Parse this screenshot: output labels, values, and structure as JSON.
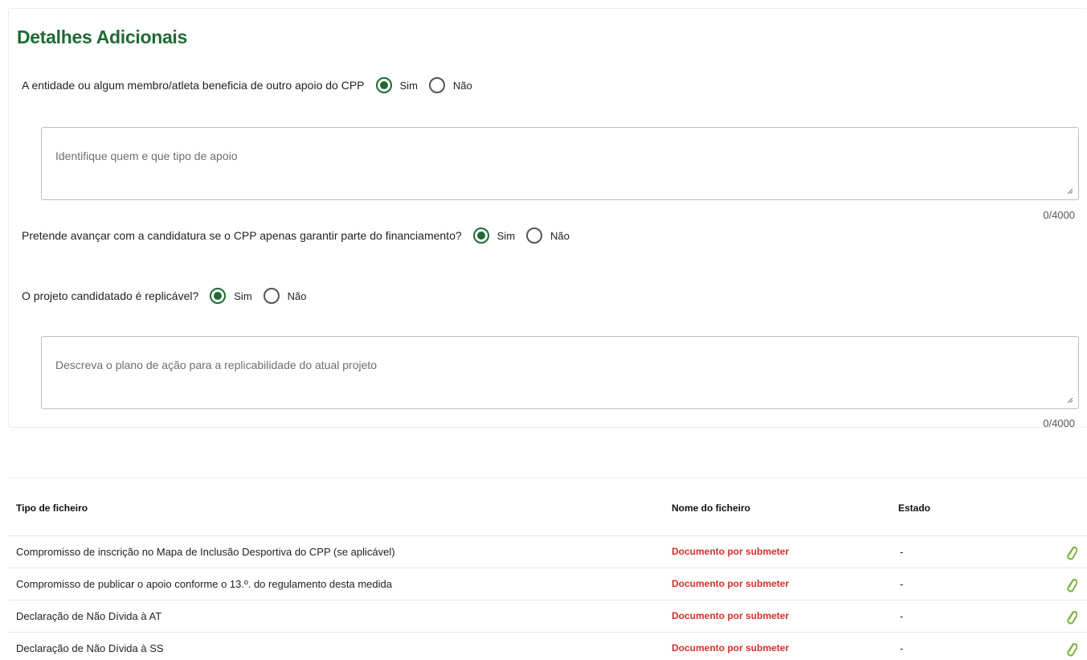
{
  "section": {
    "title": "Detalhes Adicionais"
  },
  "questions": [
    {
      "text": "A entidade ou algum membro/atleta beneficia de outro apoio do CPP",
      "yes_label": "Sim",
      "no_label": "Não",
      "selected": "Sim"
    },
    {
      "text": "Pretende avançar com a candidatura se o CPP apenas garantir parte do financiamento?",
      "yes_label": "Sim",
      "no_label": "Não",
      "selected": "Sim"
    },
    {
      "text": "O projeto candidatado é replicável?",
      "yes_label": "Sim",
      "no_label": "Não",
      "selected": "Sim"
    }
  ],
  "textareas": [
    {
      "placeholder": "Identifique quem e que tipo de apoio",
      "counter": "0/4000"
    },
    {
      "placeholder": "Descreva o plano de ação para a replicabilidade do atual projeto",
      "counter": "0/4000"
    }
  ],
  "files_table": {
    "headers": {
      "type": "Tipo de ficheiro",
      "name": "Nome do ficheiro",
      "status": "Estado"
    },
    "rows": [
      {
        "type": "Compromisso de inscrição no Mapa de Inclusão Desportiva do CPP (se aplicável)",
        "name": "Documento por submeter",
        "status": "-",
        "icon": "paperclip-icon"
      },
      {
        "type": "Compromisso de publicar o apoio conforme o 13.º. do regulamento desta medida",
        "name": "Documento por submeter",
        "status": "-",
        "icon": "paperclip-icon"
      },
      {
        "type": "Declaração de Não Dívida à AT",
        "name": "Documento por submeter",
        "status": "-",
        "icon": "paperclip-icon"
      },
      {
        "type": "Declaração de Não Dívida à SS",
        "name": "Documento por submeter",
        "status": "-",
        "icon": "paperclip-icon"
      }
    ]
  },
  "colors": {
    "accent": "#1e6b34",
    "pending": "#d32f2f"
  }
}
